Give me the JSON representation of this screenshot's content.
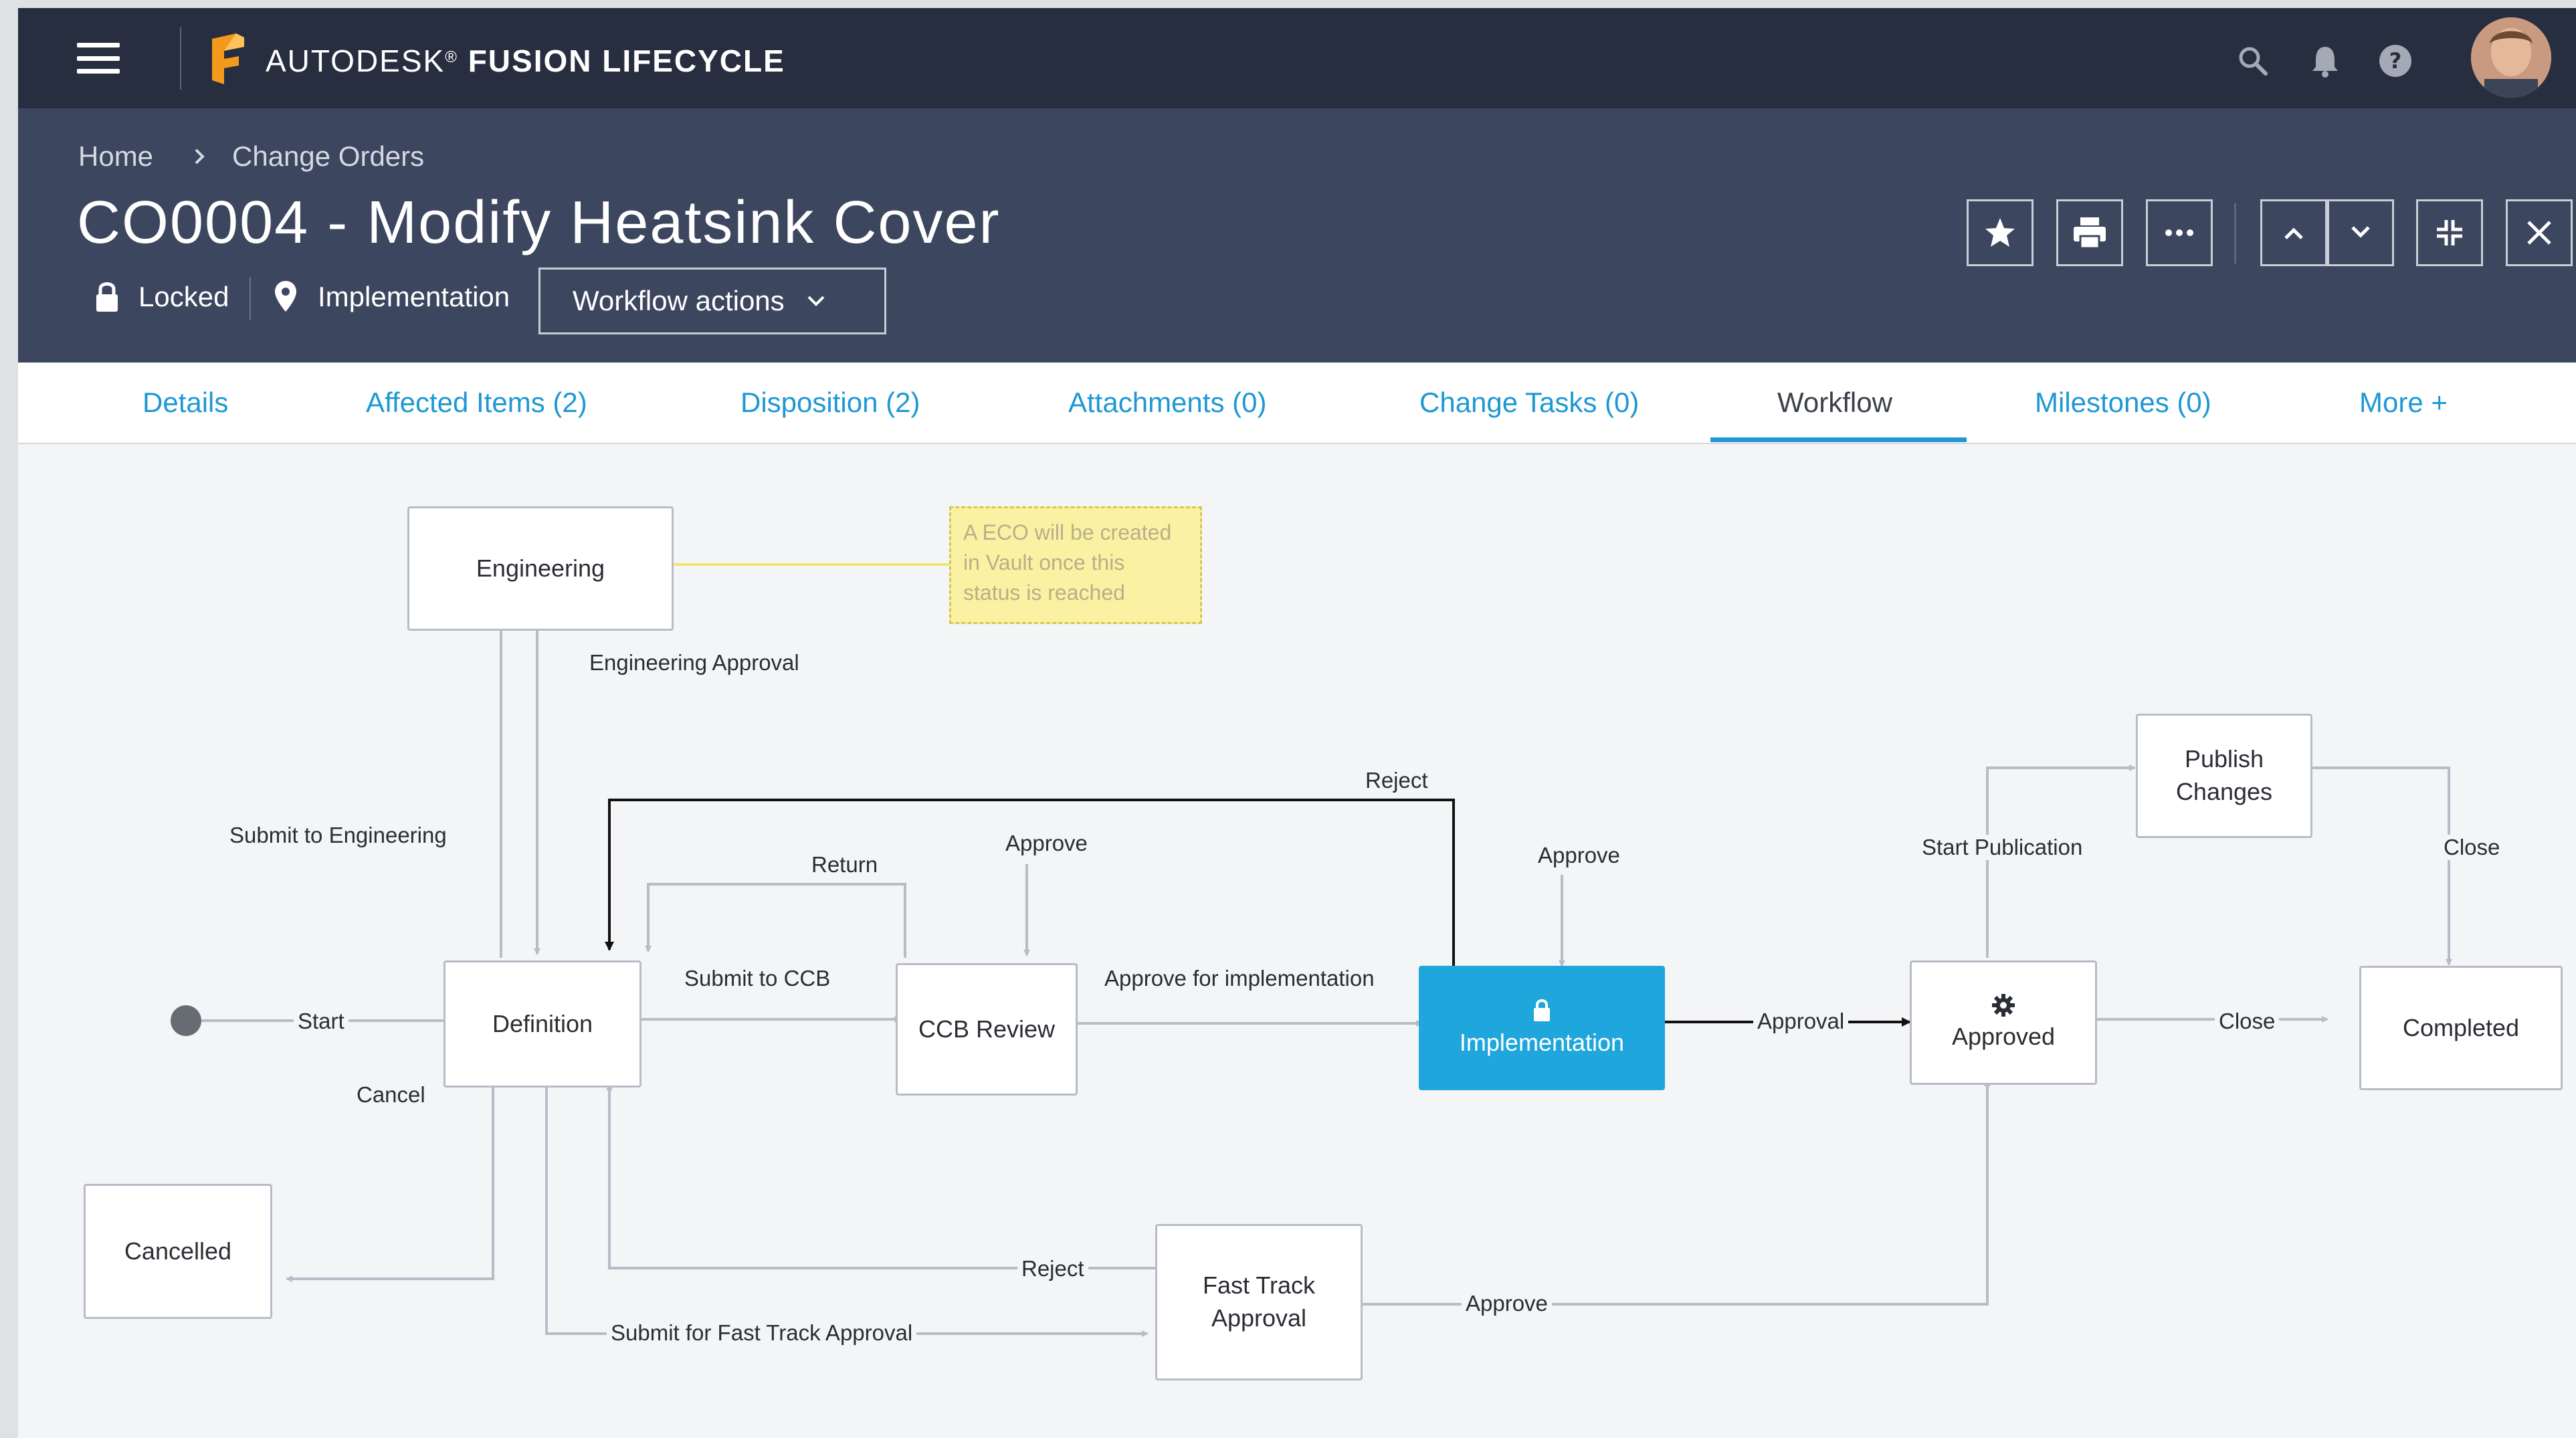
{
  "topbar": {
    "brand_prefix": "AUTODESK",
    "brand_mark": "®",
    "brand_product": "FUSION LIFECYCLE",
    "icons": [
      "menu-icon",
      "fusion-logo",
      "search-icon",
      "bell-icon",
      "help-icon",
      "user-avatar"
    ]
  },
  "breadcrumb": {
    "home": "Home",
    "separator_icon": "chevron-right-icon",
    "current": "Change Orders"
  },
  "record": {
    "title": "CO0004 - Modify Heatsink Cover",
    "lock_status": "Locked",
    "workflow_state": "Implementation",
    "workflow_actions_label": "Workflow actions"
  },
  "header_buttons": [
    "star-icon",
    "print-icon",
    "more-icon",
    "previous-icon",
    "next-icon",
    "collapse-icon",
    "close-icon"
  ],
  "tabs": [
    {
      "label": "Details",
      "active": false
    },
    {
      "label": "Affected Items (2)",
      "active": false
    },
    {
      "label": "Disposition (2)",
      "active": false
    },
    {
      "label": "Attachments (0)",
      "active": false
    },
    {
      "label": "Change Tasks (0)",
      "active": false
    },
    {
      "label": "Workflow",
      "active": true
    },
    {
      "label": "Milestones (0)",
      "active": false
    },
    {
      "label": "More +",
      "active": false
    }
  ],
  "workflow": {
    "states": {
      "engineering": "Engineering",
      "definition": "Definition",
      "ccb_review": "CCB Review",
      "implementation": "Implementation",
      "approved": "Approved",
      "publish_line1": "Publish",
      "publish_line2": "Changes",
      "completed": "Completed",
      "cancelled": "Cancelled",
      "fast_track_line1": "Fast Track",
      "fast_track_line2": "Approval"
    },
    "transitions": {
      "start": "Start",
      "submit_to_engineering": "Submit to Engineering",
      "engineering_approval": "Engineering Approval",
      "submit_to_ccb": "Submit to CCB",
      "return": "Return",
      "approve_ccb": "Approve",
      "reject_top": "Reject",
      "approve_impl": "Approve",
      "approve_for_implementation": "Approve for implementation",
      "approval": "Approval",
      "close_approved": "Close",
      "start_publication": "Start Publication",
      "close_publish": "Close",
      "cancel": "Cancel",
      "reject_fast_track": "Reject",
      "submit_fast_track": "Submit for Fast Track Approval",
      "approve_fast_track": "Approve"
    },
    "note_lines": [
      "A ECO will be created",
      "in Vault once this",
      "status is reached"
    ]
  },
  "colors": {
    "topbar": "#272e3f",
    "header": "#3d465f",
    "accent": "#1e98d3",
    "active_state": "#1fa6dd",
    "note": "#fbf1a3"
  }
}
